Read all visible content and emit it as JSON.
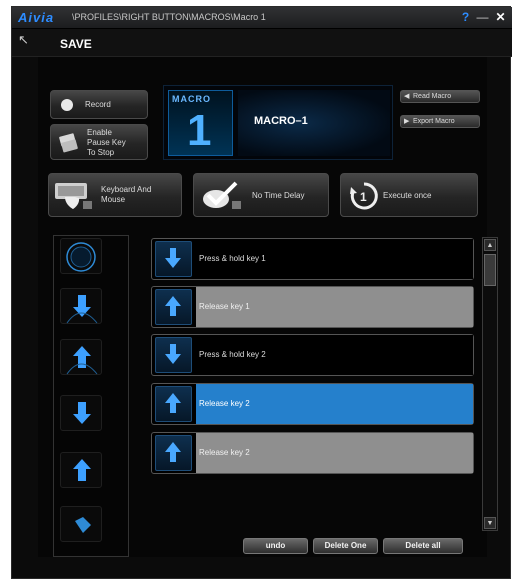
{
  "titlebar": {
    "brand": "Aivia",
    "path": "\\PROFILES\\RIGHT BUTTON\\MACROS\\Macro 1",
    "help_glyph": "?",
    "minimize_glyph": "—",
    "close_glyph": "✕"
  },
  "toolbar": {
    "back_glyph": "↖",
    "save_label": "SAVE"
  },
  "buttons": {
    "record": "Record",
    "enable_pause_line1": "Enable",
    "enable_pause_line2": "Pause Key",
    "enable_pause_line3": "To Stop",
    "keyboard_mouse_line1": "Keyboard And",
    "keyboard_mouse_line2": "Mouse",
    "no_time_delay": "No Time Delay",
    "execute_once": "Execute once",
    "read_macro": "Read Macro",
    "export_macro": "Export Macro"
  },
  "macro": {
    "panel_label": "MACRO",
    "number": "1",
    "name": "MACRO–1"
  },
  "events": [
    {
      "label": "Press & hold key 1",
      "direction": "down",
      "style": "dark"
    },
    {
      "label": "Release key 1",
      "direction": "up",
      "style": "gray"
    },
    {
      "label": "Press & hold key 2",
      "direction": "down",
      "style": "dark"
    },
    {
      "label": "Release key 2",
      "direction": "up",
      "style": "blue"
    },
    {
      "label": "Release key 2",
      "direction": "up",
      "style": "gray"
    }
  ],
  "left_tools": [
    "timer-icon",
    "press-down-icon",
    "release-up-icon",
    "press-down-icon",
    "release-up-icon",
    "mouse-click-icon"
  ],
  "bottom": {
    "undo": "undo",
    "delete_one": "Delete One",
    "delete_all": "Delete all"
  },
  "colors": {
    "accent": "#2580cc",
    "brand": "#2d8cff",
    "row_gray": "#8f8f8f"
  }
}
